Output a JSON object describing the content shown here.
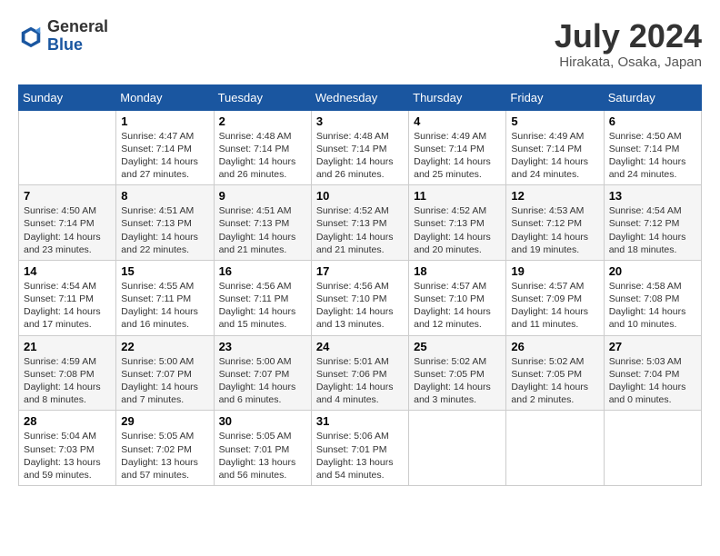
{
  "header": {
    "logo_general": "General",
    "logo_blue": "Blue",
    "month_year": "July 2024",
    "location": "Hirakata, Osaka, Japan"
  },
  "days_of_week": [
    "Sunday",
    "Monday",
    "Tuesday",
    "Wednesday",
    "Thursday",
    "Friday",
    "Saturday"
  ],
  "weeks": [
    [
      {
        "day": "",
        "info": ""
      },
      {
        "day": "1",
        "info": "Sunrise: 4:47 AM\nSunset: 7:14 PM\nDaylight: 14 hours\nand 27 minutes."
      },
      {
        "day": "2",
        "info": "Sunrise: 4:48 AM\nSunset: 7:14 PM\nDaylight: 14 hours\nand 26 minutes."
      },
      {
        "day": "3",
        "info": "Sunrise: 4:48 AM\nSunset: 7:14 PM\nDaylight: 14 hours\nand 26 minutes."
      },
      {
        "day": "4",
        "info": "Sunrise: 4:49 AM\nSunset: 7:14 PM\nDaylight: 14 hours\nand 25 minutes."
      },
      {
        "day": "5",
        "info": "Sunrise: 4:49 AM\nSunset: 7:14 PM\nDaylight: 14 hours\nand 24 minutes."
      },
      {
        "day": "6",
        "info": "Sunrise: 4:50 AM\nSunset: 7:14 PM\nDaylight: 14 hours\nand 24 minutes."
      }
    ],
    [
      {
        "day": "7",
        "info": "Sunrise: 4:50 AM\nSunset: 7:14 PM\nDaylight: 14 hours\nand 23 minutes."
      },
      {
        "day": "8",
        "info": "Sunrise: 4:51 AM\nSunset: 7:13 PM\nDaylight: 14 hours\nand 22 minutes."
      },
      {
        "day": "9",
        "info": "Sunrise: 4:51 AM\nSunset: 7:13 PM\nDaylight: 14 hours\nand 21 minutes."
      },
      {
        "day": "10",
        "info": "Sunrise: 4:52 AM\nSunset: 7:13 PM\nDaylight: 14 hours\nand 21 minutes."
      },
      {
        "day": "11",
        "info": "Sunrise: 4:52 AM\nSunset: 7:13 PM\nDaylight: 14 hours\nand 20 minutes."
      },
      {
        "day": "12",
        "info": "Sunrise: 4:53 AM\nSunset: 7:12 PM\nDaylight: 14 hours\nand 19 minutes."
      },
      {
        "day": "13",
        "info": "Sunrise: 4:54 AM\nSunset: 7:12 PM\nDaylight: 14 hours\nand 18 minutes."
      }
    ],
    [
      {
        "day": "14",
        "info": "Sunrise: 4:54 AM\nSunset: 7:11 PM\nDaylight: 14 hours\nand 17 minutes."
      },
      {
        "day": "15",
        "info": "Sunrise: 4:55 AM\nSunset: 7:11 PM\nDaylight: 14 hours\nand 16 minutes."
      },
      {
        "day": "16",
        "info": "Sunrise: 4:56 AM\nSunset: 7:11 PM\nDaylight: 14 hours\nand 15 minutes."
      },
      {
        "day": "17",
        "info": "Sunrise: 4:56 AM\nSunset: 7:10 PM\nDaylight: 14 hours\nand 13 minutes."
      },
      {
        "day": "18",
        "info": "Sunrise: 4:57 AM\nSunset: 7:10 PM\nDaylight: 14 hours\nand 12 minutes."
      },
      {
        "day": "19",
        "info": "Sunrise: 4:57 AM\nSunset: 7:09 PM\nDaylight: 14 hours\nand 11 minutes."
      },
      {
        "day": "20",
        "info": "Sunrise: 4:58 AM\nSunset: 7:08 PM\nDaylight: 14 hours\nand 10 minutes."
      }
    ],
    [
      {
        "day": "21",
        "info": "Sunrise: 4:59 AM\nSunset: 7:08 PM\nDaylight: 14 hours\nand 8 minutes."
      },
      {
        "day": "22",
        "info": "Sunrise: 5:00 AM\nSunset: 7:07 PM\nDaylight: 14 hours\nand 7 minutes."
      },
      {
        "day": "23",
        "info": "Sunrise: 5:00 AM\nSunset: 7:07 PM\nDaylight: 14 hours\nand 6 minutes."
      },
      {
        "day": "24",
        "info": "Sunrise: 5:01 AM\nSunset: 7:06 PM\nDaylight: 14 hours\nand 4 minutes."
      },
      {
        "day": "25",
        "info": "Sunrise: 5:02 AM\nSunset: 7:05 PM\nDaylight: 14 hours\nand 3 minutes."
      },
      {
        "day": "26",
        "info": "Sunrise: 5:02 AM\nSunset: 7:05 PM\nDaylight: 14 hours\nand 2 minutes."
      },
      {
        "day": "27",
        "info": "Sunrise: 5:03 AM\nSunset: 7:04 PM\nDaylight: 14 hours\nand 0 minutes."
      }
    ],
    [
      {
        "day": "28",
        "info": "Sunrise: 5:04 AM\nSunset: 7:03 PM\nDaylight: 13 hours\nand 59 minutes."
      },
      {
        "day": "29",
        "info": "Sunrise: 5:05 AM\nSunset: 7:02 PM\nDaylight: 13 hours\nand 57 minutes."
      },
      {
        "day": "30",
        "info": "Sunrise: 5:05 AM\nSunset: 7:01 PM\nDaylight: 13 hours\nand 56 minutes."
      },
      {
        "day": "31",
        "info": "Sunrise: 5:06 AM\nSunset: 7:01 PM\nDaylight: 13 hours\nand 54 minutes."
      },
      {
        "day": "",
        "info": ""
      },
      {
        "day": "",
        "info": ""
      },
      {
        "day": "",
        "info": ""
      }
    ]
  ]
}
